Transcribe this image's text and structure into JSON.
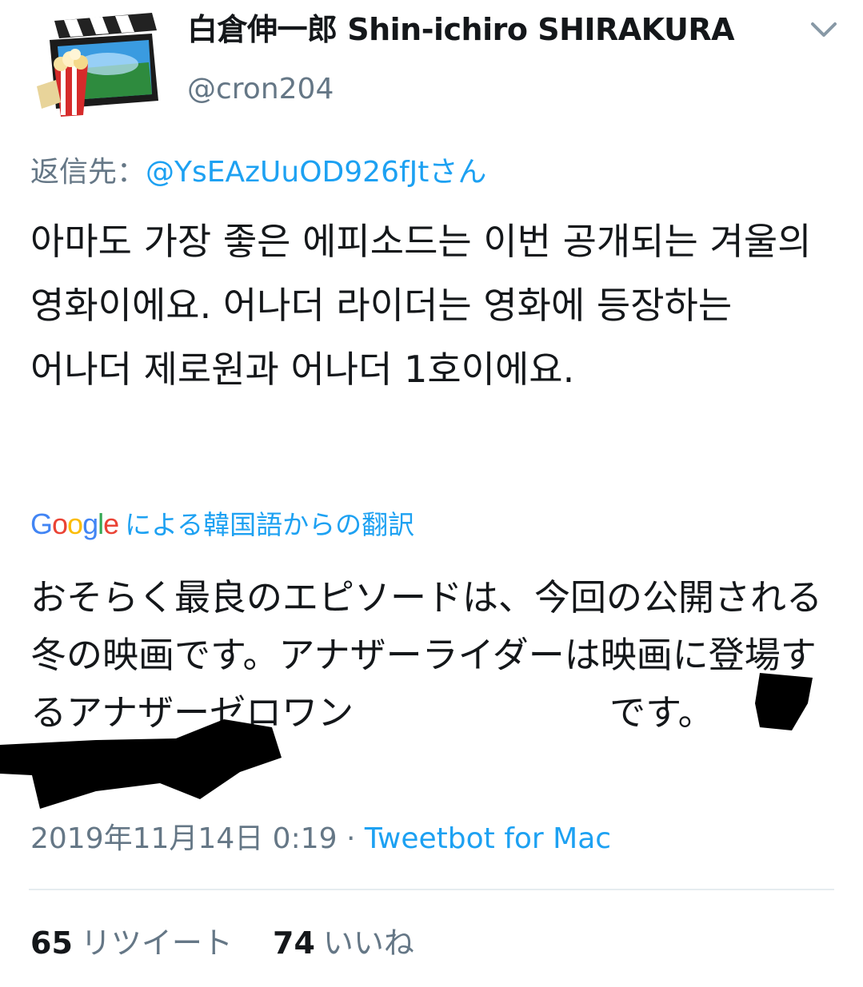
{
  "user": {
    "display_name": "白倉伸一郎 Shin-ichiro SHIRAKURA",
    "handle": "@cron204",
    "avatar_icon": "movie-clapperboard-popcorn-icon"
  },
  "header": {
    "menu_icon": "chevron-down-icon"
  },
  "reply": {
    "prefix": "返信先：",
    "mention": "@YsEAzUuOD926fJtさん"
  },
  "tweet": {
    "text": "아마도 가장 좋은 에피소드는 이번 공개되는 겨울의 영화이에요. 어나더 라이더는 영화에 등장하는 어나더 제로원과 어나더 1호이에요."
  },
  "translation": {
    "provider_logo": [
      "G",
      "o",
      "o",
      "g",
      "l",
      "e"
    ],
    "label": "による韓国語からの翻訳",
    "text": "おそらく最良のエピソードは、今回の公開される冬の映画です。アナザーライダーは映画に登場するアナザーゼロワン",
    "text_tail": "です。"
  },
  "meta": {
    "timestamp": "2019年11月14日 0:19",
    "separator": "·",
    "source": "Tweetbot for Mac"
  },
  "stats": {
    "retweets_count": "65",
    "retweets_label": "リツイート",
    "likes_count": "74",
    "likes_label": "いいね"
  },
  "colors": {
    "link": "#1da1f2",
    "secondary_text": "#657786",
    "primary_text": "#14171a",
    "divider": "#e6ecf0"
  }
}
